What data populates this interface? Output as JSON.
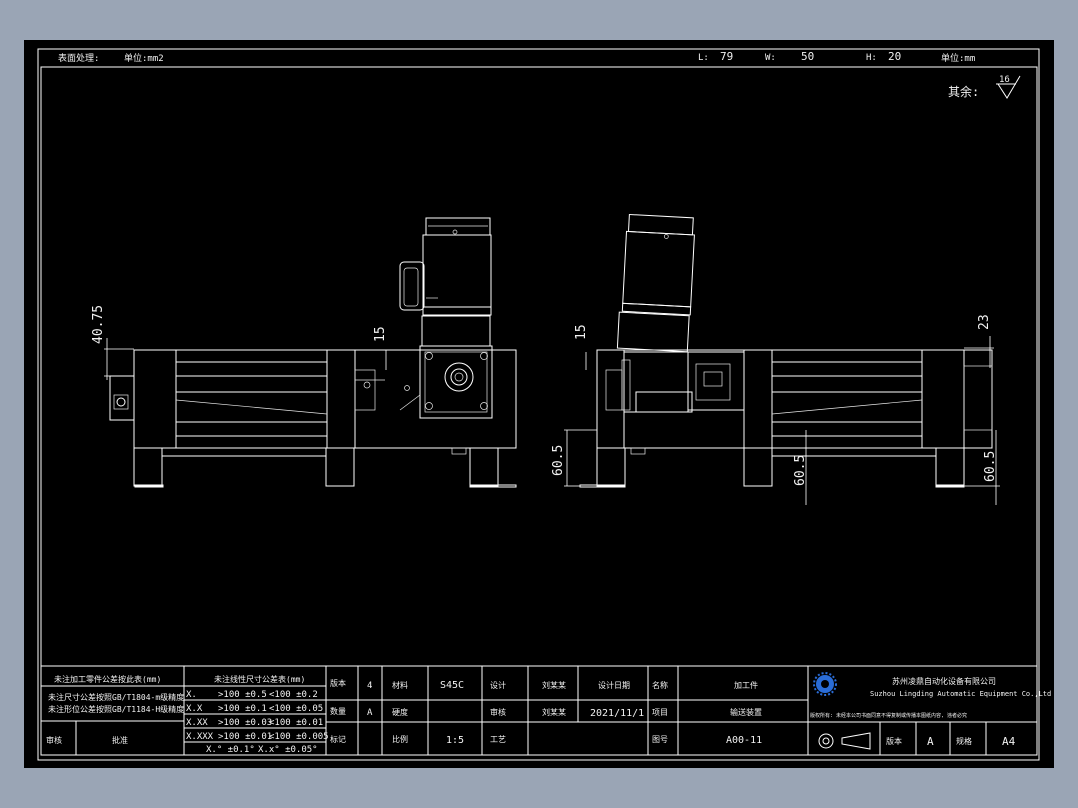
{
  "header": {
    "surface_treatment_label": "表面处理:",
    "unit_area_label": "单位:mm2",
    "L_label": "L:",
    "L_value": "79",
    "W_label": "W:",
    "W_value": "50",
    "H_label": "H:",
    "H_value": "20",
    "unit_label": "单位:mm",
    "rest_label": "其余:",
    "roughness_value": "16"
  },
  "dimensions": {
    "left_view": [
      "40.75",
      "15"
    ],
    "right_view": [
      "15",
      "23",
      "60.5",
      "60.5",
      "60.5"
    ]
  },
  "title_block": {
    "notes": [
      "未注加工零件公差按此表(mm)",
      "未注尺寸公差按照GB/T1804-m级精度",
      "未注形位公差按照GB/T1184-H级精度"
    ],
    "tolerance_title": "未注线性尺寸公差表(mm)",
    "tolerance_rows": [
      {
        "fmt": "X.",
        "a": ">100 ±0.5",
        "b": "<100 ±0.2"
      },
      {
        "fmt": "X.X",
        "a": ">100 ±0.1",
        "b": "<100 ±0.05"
      },
      {
        "fmt": "X.XX",
        "a": ">100 ±0.03",
        "b": "<100 ±0.01"
      },
      {
        "fmt": "X.XXX",
        "a": ">100 ±0.01",
        "b": "<100 ±0.005"
      }
    ],
    "angle_tol_a": "X.° ±0.1°",
    "angle_tol_b": "X.x° ±0.05°",
    "review_label": "审核",
    "approve_label": "批准",
    "version_label": "版本",
    "quantity_label": "数量",
    "mark_label": "标记",
    "quantity_value": "4",
    "mark_value": "A",
    "material_label": "材料",
    "material_value": "S45C",
    "hardness_label": "硬度",
    "scale_label": "比例",
    "scale_value": "1:5",
    "design_label": "设计",
    "check_label": "审核",
    "process_label": "工艺",
    "designer": "刘某某",
    "checker": "刘某某",
    "date_label": "设计日期",
    "date_value": "2021/11/1",
    "name_label": "名称",
    "name_value": "加工件",
    "project_label": "项目",
    "project_value": "输送装置",
    "drawing_no_label": "图号",
    "drawing_no_value": "A00-11",
    "company_cn": "苏州凌鼎自动化设备有限公司",
    "company_en": "Suzhou Lingding Automatic Equipment Co.,Ltd",
    "copyright_note": "版权所有: 未经本公司书面同意不得复制或传播本图纸内容, 违者必究",
    "page_label": "版本",
    "page_value": "A",
    "size_label": "规格",
    "size_value": "A4"
  },
  "colors": {
    "window_bg": "#9aa5b5",
    "sheet_bg": "#000000",
    "line": "#ffffff",
    "logo": "#2a6cd6"
  }
}
